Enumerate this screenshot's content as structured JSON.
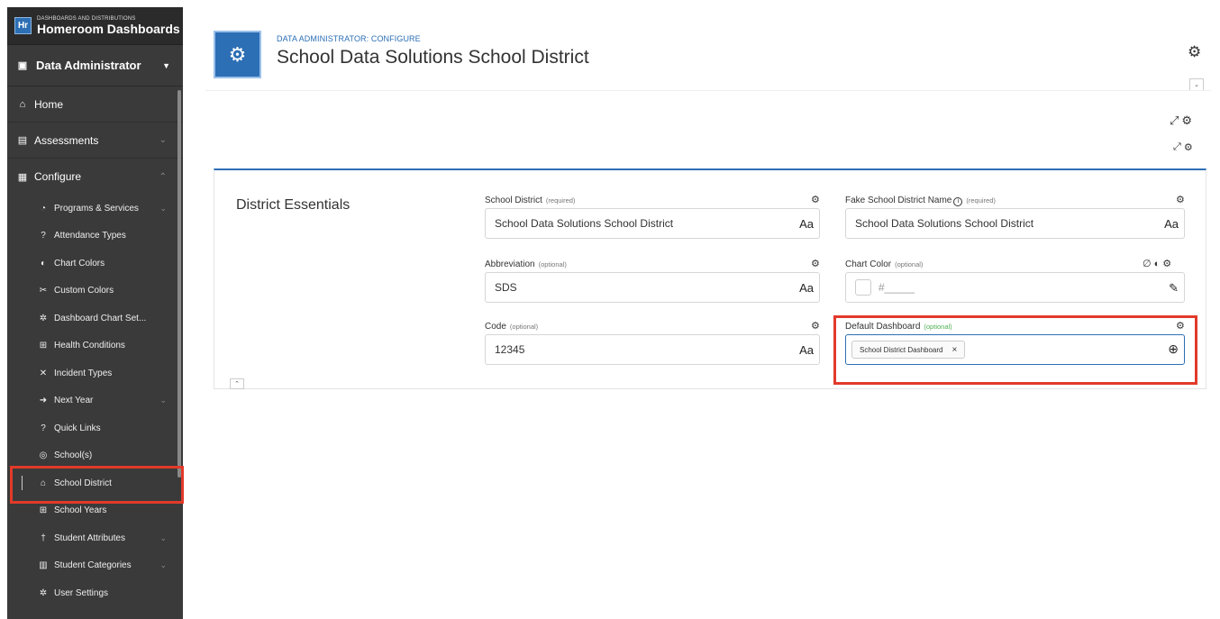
{
  "brand": {
    "subtitle": "DASHBOARDS AND DISTRIBUTIONS",
    "title": "Homeroom Dashboards",
    "logo_text": "Hr"
  },
  "role": {
    "label": "Data Administrator",
    "icon": "id-card-icon"
  },
  "nav": {
    "home": "Home",
    "assessments": "Assessments",
    "configure": "Configure",
    "items": [
      {
        "label": "Programs & Services",
        "icon": "pie-chart-icon",
        "expandable": true
      },
      {
        "label": "Attendance Types",
        "icon": "question-circle-icon",
        "expandable": false
      },
      {
        "label": "Chart Colors",
        "icon": "palette-icon",
        "expandable": false
      },
      {
        "label": "Custom Colors",
        "icon": "tools-icon",
        "expandable": false
      },
      {
        "label": "Dashboard Chart Set...",
        "icon": "gear-icon",
        "expandable": false
      },
      {
        "label": "Health Conditions",
        "icon": "calendar-plus-icon",
        "expandable": false
      },
      {
        "label": "Incident Types",
        "icon": "incident-icon",
        "expandable": false
      },
      {
        "label": "Next Year",
        "icon": "arrow-circle-icon",
        "expandable": true
      },
      {
        "label": "Quick Links",
        "icon": "question-circle-icon",
        "expandable": false
      },
      {
        "label": "School(s)",
        "icon": "school-icon",
        "expandable": false
      },
      {
        "label": "School District",
        "icon": "district-icon",
        "expandable": false
      },
      {
        "label": "School Years",
        "icon": "calendar-icon",
        "expandable": false
      },
      {
        "label": "Student Attributes",
        "icon": "student-icon",
        "expandable": true
      },
      {
        "label": "Student Categories",
        "icon": "books-icon",
        "expandable": true
      },
      {
        "label": "User Settings",
        "icon": "gear-icon",
        "expandable": false
      }
    ]
  },
  "header": {
    "breadcrumb": "DATA ADMINISTRATOR: CONFIGURE",
    "title": "School Data Solutions School District"
  },
  "card": {
    "title": "District Essentials",
    "fields": {
      "school_district": {
        "label": "School District",
        "note": "(required)",
        "value": "School Data Solutions School District",
        "suffix": "Aa"
      },
      "fake_name": {
        "label": "Fake School District Name",
        "note": "(required)",
        "value": "School Data Solutions School District",
        "suffix": "Aa"
      },
      "abbreviation": {
        "label": "Abbreviation",
        "note": "(optional)",
        "value": "SDS",
        "suffix": "Aa"
      },
      "chart_color": {
        "label": "Chart Color",
        "note": "(optional)",
        "placeholder": "#_____"
      },
      "code": {
        "label": "Code",
        "note": "(optional)",
        "value": "12345",
        "suffix": "Aa"
      },
      "default_dashboard": {
        "label": "Default Dashboard",
        "note": "(optional)",
        "chip": "School District Dashboard",
        "chip_remove": "×"
      }
    }
  },
  "colors": {
    "accent": "#2c6fb5",
    "sidebar": "#3a3a3a",
    "highlight": "#e23a2a",
    "optional_green": "#4caf50"
  }
}
